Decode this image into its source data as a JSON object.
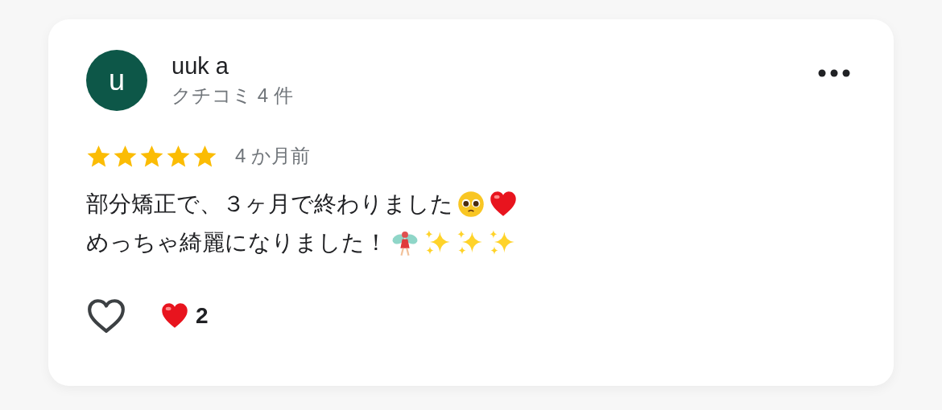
{
  "review": {
    "avatar_initial": "u",
    "name": "uuk a",
    "review_count": "クチコミ 4 件",
    "stars": 5,
    "time": "4 か月前",
    "lines": [
      {
        "text": "部分矯正で、３ヶ月で終わりました",
        "emoji": [
          {
            "kind": "face"
          },
          {
            "kind": "heart"
          }
        ]
      },
      {
        "text": "めっちゃ綺麗になりました！",
        "emoji": [
          {
            "kind": "fairy"
          },
          {
            "kind": "sparkles"
          },
          {
            "kind": "sparkles"
          },
          {
            "kind": "sparkles"
          }
        ]
      }
    ],
    "liked": false,
    "reaction_count": "2"
  }
}
